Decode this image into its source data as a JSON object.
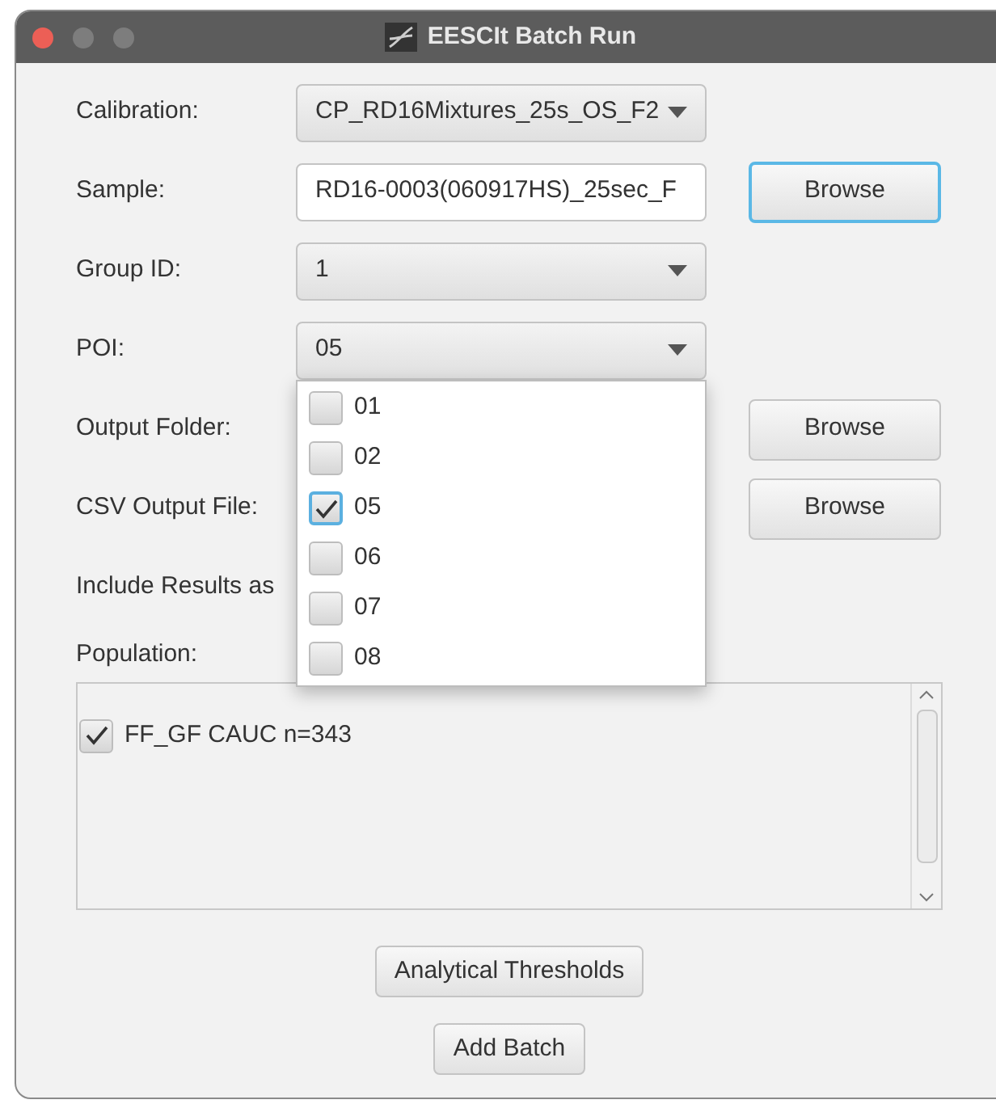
{
  "window": {
    "title": "EESCIt Batch Run"
  },
  "fields": [
    {
      "kind": "dropdown",
      "label": "Calibration:",
      "value": "CP_RD16Mixtures_25s_OS_F2"
    },
    {
      "kind": "text",
      "label": "Sample:",
      "value": "RD16-0003(060917HS)_25sec_F",
      "button": {
        "label": "Browse",
        "focused": true
      }
    },
    {
      "kind": "dropdown",
      "label": "Group ID:",
      "value": "1"
    },
    {
      "kind": "dropdown",
      "label": "POI:",
      "value": "05",
      "expanded": true,
      "options": [
        {
          "label": "01",
          "checked": false
        },
        {
          "label": "02",
          "checked": false
        },
        {
          "label": "05",
          "checked": true
        },
        {
          "label": "06",
          "checked": false
        },
        {
          "label": "07",
          "checked": false
        },
        {
          "label": "08",
          "checked": false
        }
      ]
    },
    {
      "kind": "label",
      "label": "Output Folder:",
      "button": {
        "label": "Browse",
        "focused": false
      }
    },
    {
      "kind": "label",
      "label": "CSV Output File:",
      "button": {
        "label": "Browse",
        "focused": false
      }
    },
    {
      "kind": "label",
      "label": "Include Results as"
    }
  ],
  "population": {
    "label": "Population:",
    "items": [
      {
        "label": "FF_GF CAUC n=343",
        "checked": true
      }
    ]
  },
  "buttons": [
    "Analytical Thresholds",
    "Add Batch"
  ]
}
